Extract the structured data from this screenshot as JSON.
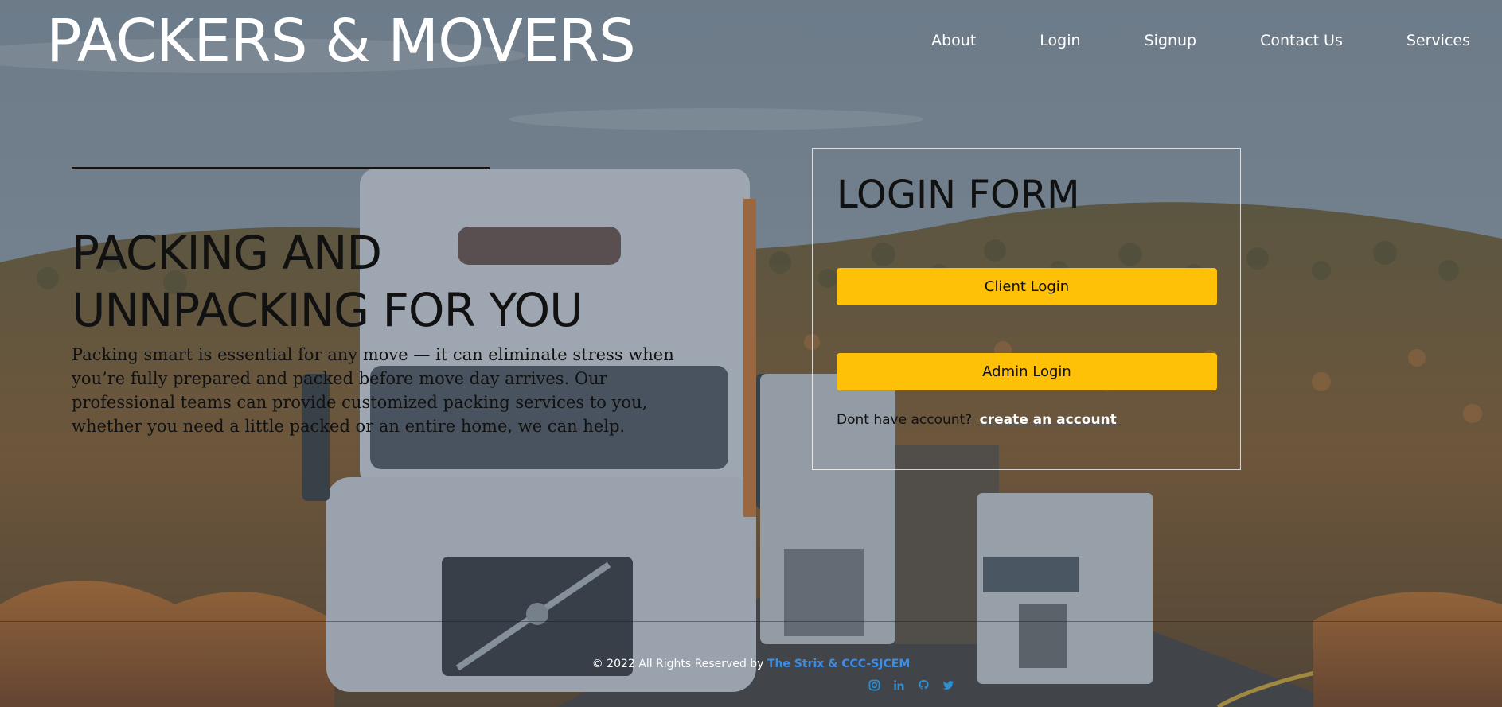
{
  "header": {
    "brand": "PACKERS & MOVERS",
    "nav": [
      "About",
      "Login",
      "Signup",
      "Contact Us",
      "Services"
    ]
  },
  "hero": {
    "title": "PACKING AND UNNPACKING FOR YOU",
    "text": "Packing smart is essential for any move — it can eliminate stress when you’re fully prepared and packed before move day arrives. Our professional teams can provide customized packing services to you, whether you need a little packed or an entire home, we can help."
  },
  "login": {
    "title": "LOGIN FORM",
    "client_button": "Client Login",
    "admin_button": "Admin Login",
    "no_account_text": "Dont have account?",
    "create_account_link": "create an account"
  },
  "footer": {
    "copyright_text": "© 2022 All Rights Reserved by",
    "credit": "The Strix & CCC-SJCEM",
    "socials": [
      "instagram-icon",
      "linkedin-icon",
      "github-icon",
      "twitter-icon"
    ]
  },
  "colors": {
    "accent": "#ffc107",
    "credit": "#3b8ee8",
    "social_icons": "#2a8fd6"
  }
}
